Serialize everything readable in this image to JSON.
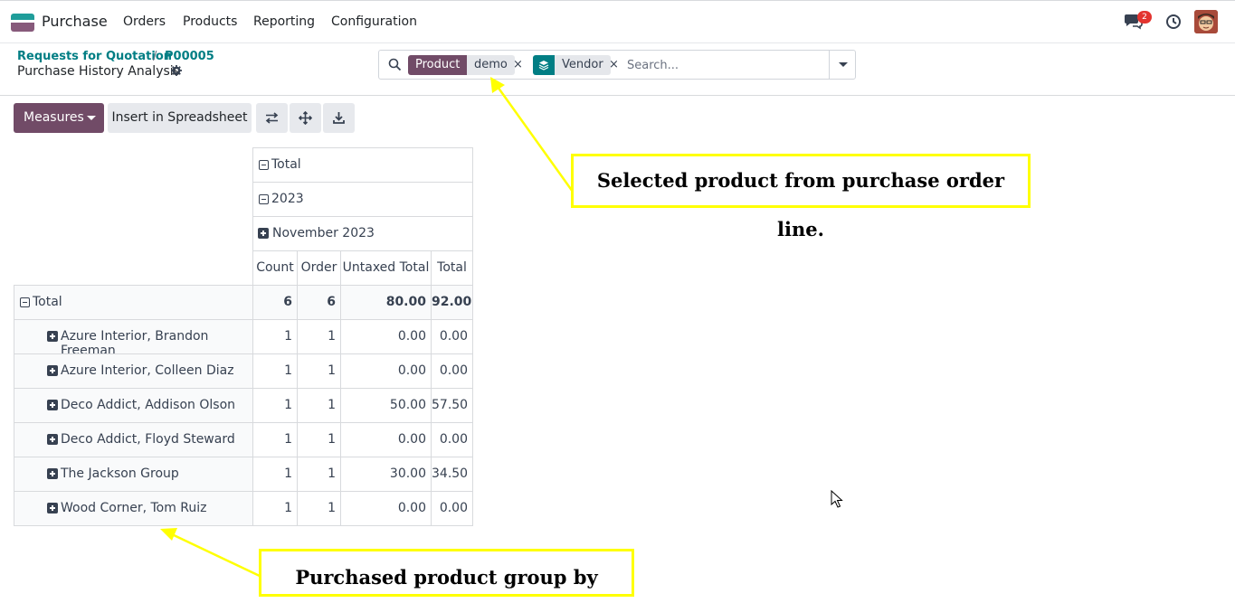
{
  "navbar": {
    "app_name": "Purchase",
    "menu": [
      "Orders",
      "Products",
      "Reporting",
      "Configuration"
    ],
    "messages_count": "2",
    "brand_color": "#714b67"
  },
  "breadcrumb": {
    "parent": "Requests for Quotation",
    "record": "P00005",
    "separator": "/",
    "title": "Purchase History Analysis"
  },
  "search": {
    "facets": [
      {
        "label": "Product",
        "value": "demo",
        "color": "#714b67",
        "icon": "filter-icon"
      },
      {
        "label": "",
        "value": "Vendor",
        "color": "#017e84",
        "icon": "layers-icon"
      }
    ],
    "placeholder": "Search..."
  },
  "toolbar": {
    "measures_label": "Measures",
    "insert_label": "Insert in Spreadsheet",
    "icons": [
      "flip-axis-icon",
      "expand-all-icon",
      "download-icon"
    ]
  },
  "pivot": {
    "col_headers": [
      "Total",
      "2023",
      "November 2023"
    ],
    "measures": [
      "Count",
      "Order",
      "Untaxed Total",
      "Total"
    ],
    "total_row": {
      "label": "Total",
      "values": [
        "6",
        "6",
        "80.00",
        "92.00"
      ]
    },
    "rows": [
      {
        "label": "Azure Interior, Brandon Freeman",
        "values": [
          "1",
          "1",
          "0.00",
          "0.00"
        ]
      },
      {
        "label": "Azure Interior, Colleen Diaz",
        "values": [
          "1",
          "1",
          "0.00",
          "0.00"
        ]
      },
      {
        "label": "Deco Addict, Addison Olson",
        "values": [
          "1",
          "1",
          "50.00",
          "57.50"
        ]
      },
      {
        "label": "Deco Addict, Floyd Steward",
        "values": [
          "1",
          "1",
          "0.00",
          "0.00"
        ]
      },
      {
        "label": "The Jackson Group",
        "values": [
          "1",
          "1",
          "30.00",
          "34.50"
        ]
      },
      {
        "label": "Wood Corner, Tom Ruiz",
        "values": [
          "1",
          "1",
          "0.00",
          "0.00"
        ]
      }
    ]
  },
  "annotations": {
    "top": "Selected product from purchase order line.",
    "bottom": "Purchased product group by vendor",
    "color": "#ffff00"
  }
}
